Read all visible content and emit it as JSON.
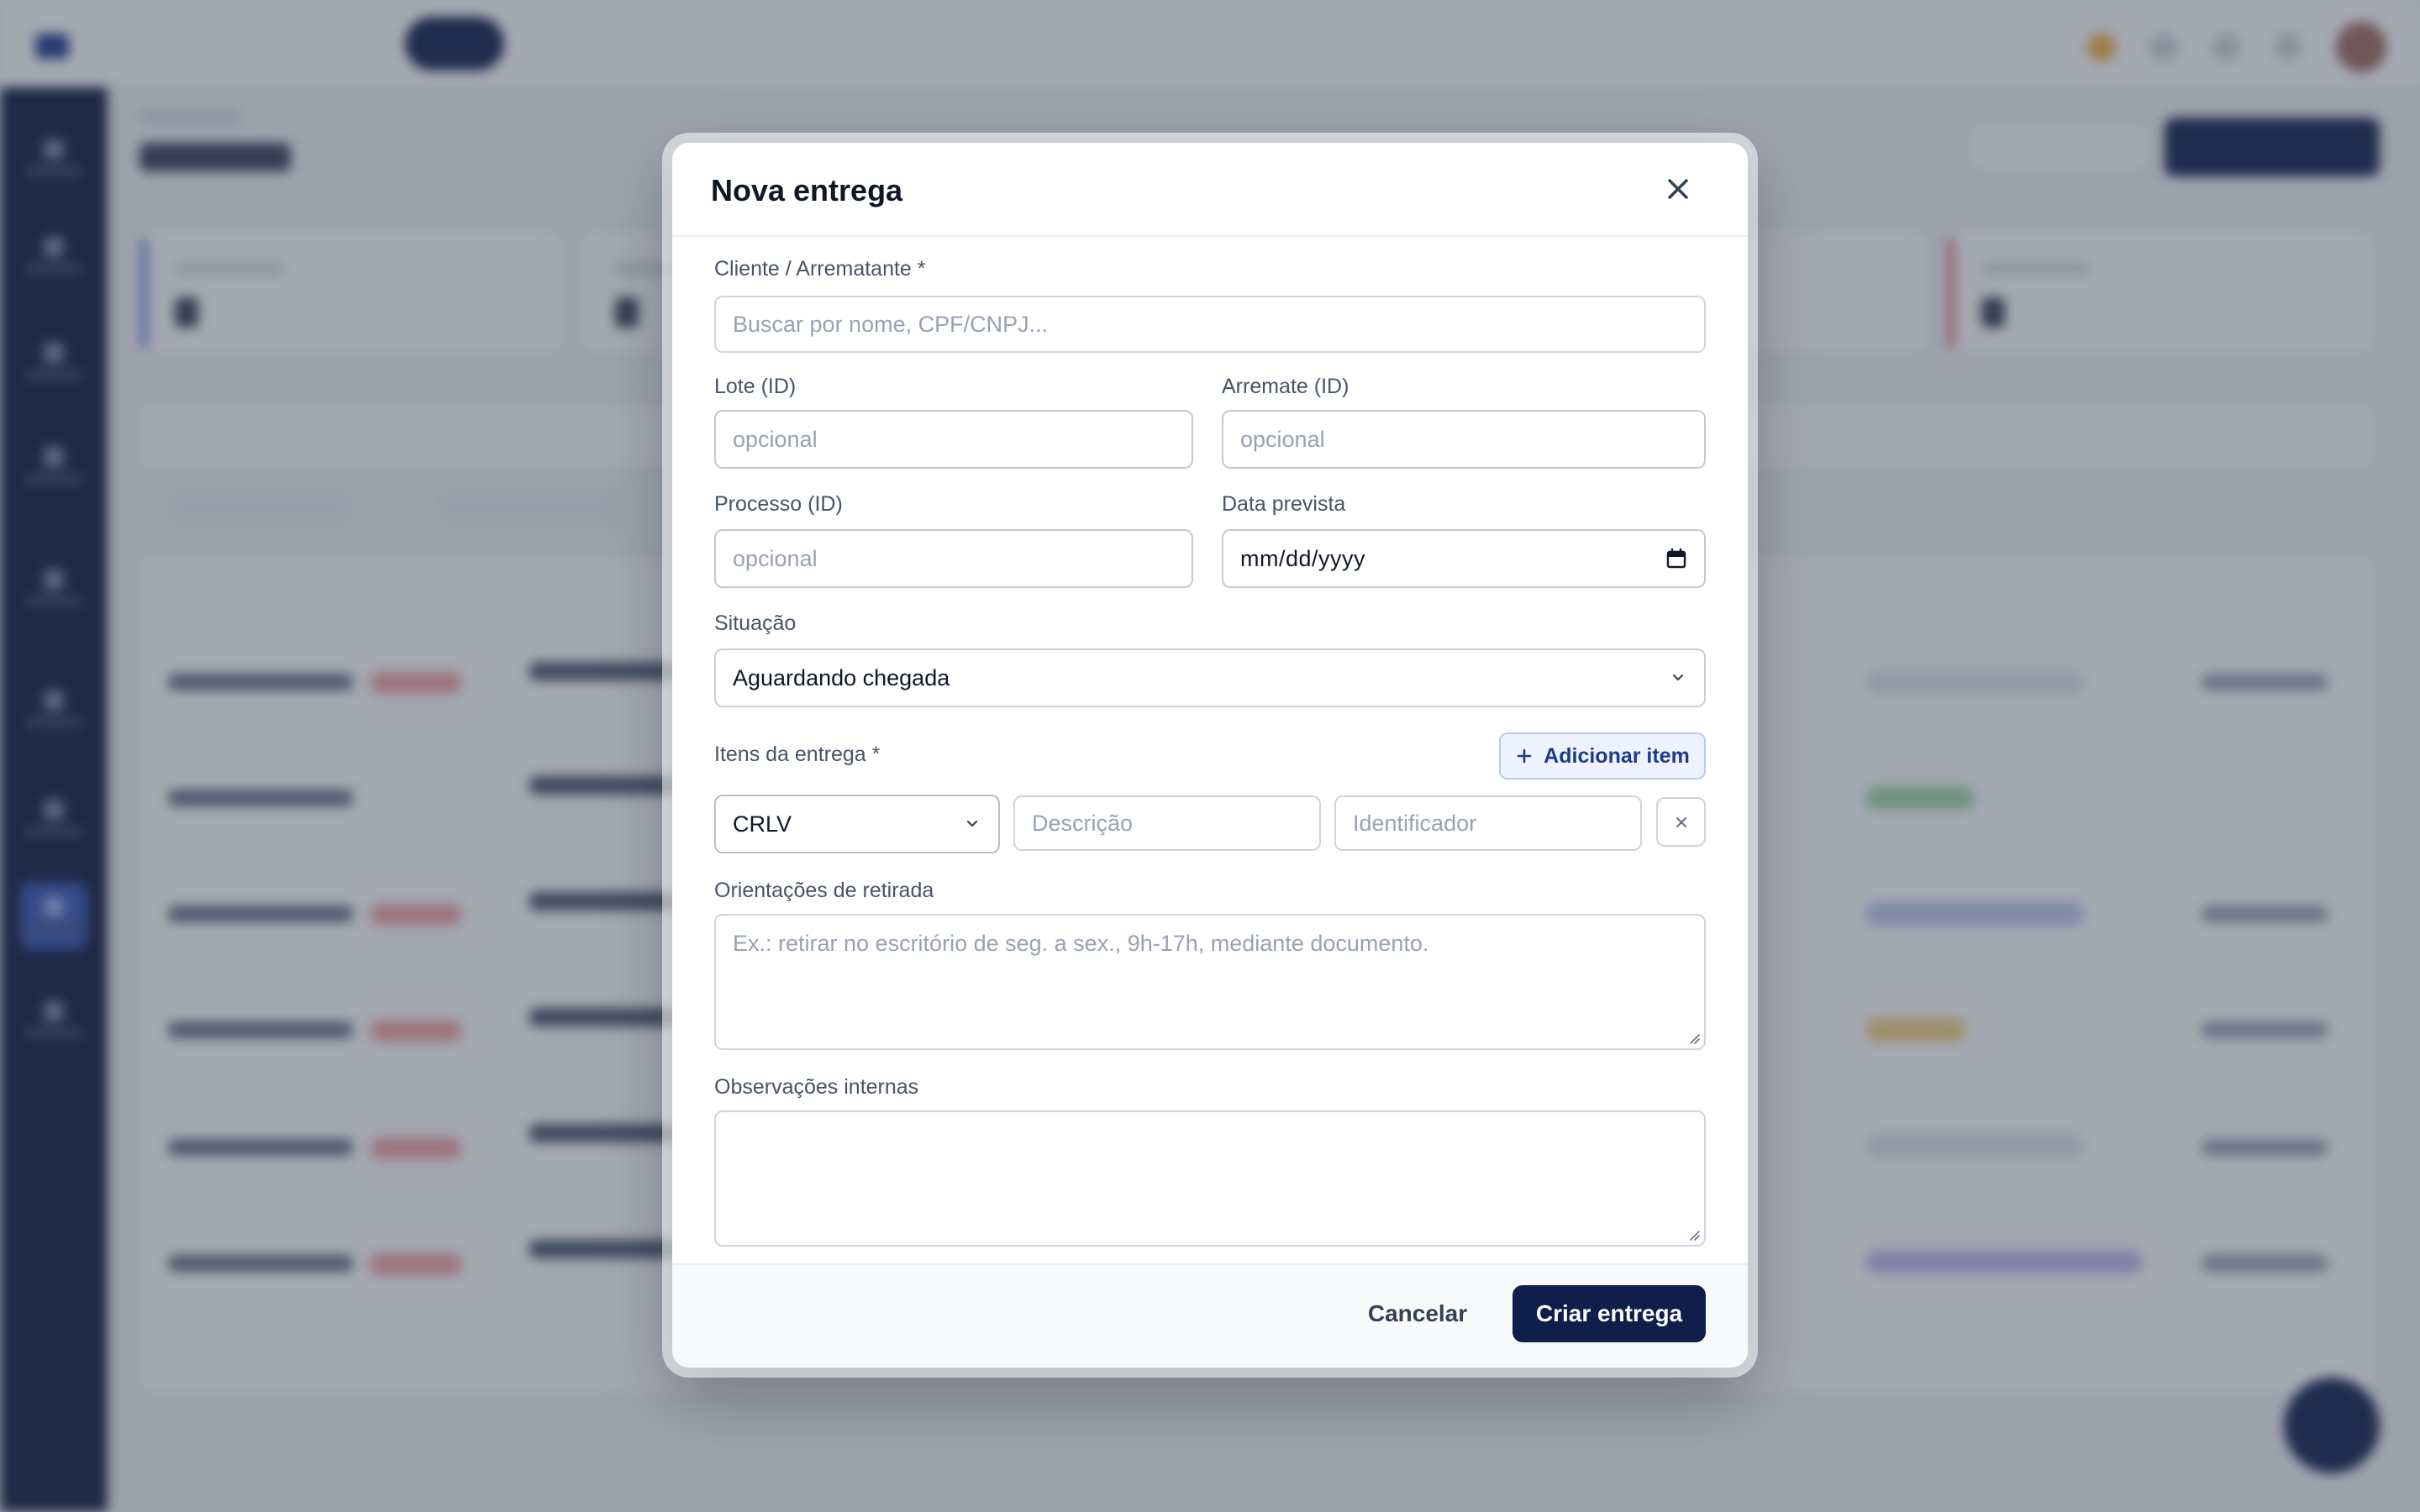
{
  "modal": {
    "title": "Nova entrega",
    "client": {
      "label": "Cliente / Arrematante *",
      "placeholder": "Buscar por nome, CPF/CNPJ..."
    },
    "lote": {
      "label": "Lote (ID)",
      "placeholder": "opcional"
    },
    "arremate": {
      "label": "Arremate (ID)",
      "placeholder": "opcional"
    },
    "processo": {
      "label": "Processo (ID)",
      "placeholder": "opcional"
    },
    "data_prevista": {
      "label": "Data prevista",
      "value": "mm/dd/yyyy"
    },
    "situacao": {
      "label": "Situação",
      "value": "Aguardando chegada"
    },
    "itens": {
      "label": "Itens da entrega *",
      "add_button": "Adicionar item",
      "rows": [
        {
          "type": "CRLV",
          "descricao_placeholder": "Descrição",
          "identificador_placeholder": "Identificador"
        }
      ]
    },
    "orientacoes": {
      "label": "Orientações de retirada",
      "placeholder": "Ex.: retirar no escritório de seg. a sex., 9h-17h, mediante documento."
    },
    "observacoes": {
      "label": "Observações internas",
      "placeholder": ""
    },
    "footer": {
      "cancel": "Cancelar",
      "submit": "Criar entrega"
    }
  },
  "colors": {
    "primary": "#0f1e4b",
    "accent": "#1e3a8a",
    "overlay": "rgba(54,62,82,0.45)"
  },
  "icons": {
    "close": "close-icon",
    "select": "chevron-down-icon",
    "date": "calendar-icon",
    "add": "plus-icon",
    "remove": "x-icon"
  }
}
